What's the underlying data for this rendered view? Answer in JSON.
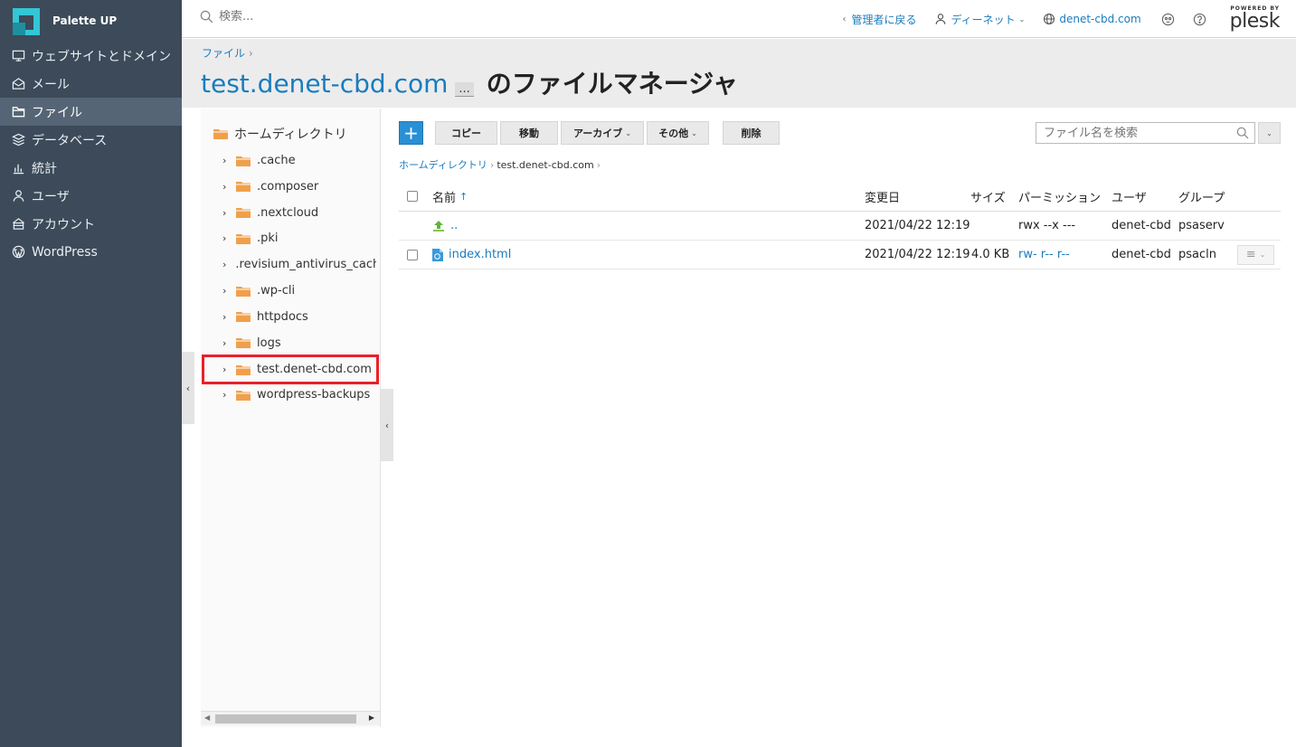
{
  "brand": {
    "name": "Palette UP"
  },
  "sidebar": {
    "items": [
      {
        "label": "ウェブサイトとドメイン",
        "icon": "monitor-icon"
      },
      {
        "label": "メール",
        "icon": "mail-icon"
      },
      {
        "label": "ファイル",
        "icon": "folder-icon",
        "active": true
      },
      {
        "label": "データベース",
        "icon": "database-icon"
      },
      {
        "label": "統計",
        "icon": "bar-chart-icon"
      },
      {
        "label": "ユーザ",
        "icon": "user-icon"
      },
      {
        "label": "アカウント",
        "icon": "account-icon"
      },
      {
        "label": "WordPress",
        "icon": "wordpress-icon"
      }
    ]
  },
  "topbar": {
    "search_placeholder": "検索...",
    "back_admin": "管理者に戻る",
    "user": "ディーネット",
    "domain": "denet-cbd.com",
    "powered_by": "POWERED BY",
    "plesk": "plesk"
  },
  "page": {
    "breadcrumb": "ファイル",
    "title_domain": "test.denet-cbd.com",
    "title_more": "...",
    "title_rest": "のファイルマネージャ"
  },
  "tree": {
    "root": "ホームディレクトリ",
    "items": [
      ".cache",
      ".composer",
      ".nextcloud",
      ".pki",
      ".revisium_antivirus_cache",
      ".wp-cli",
      "httpdocs",
      "logs",
      "test.denet-cbd.com",
      "wordpress-backups"
    ]
  },
  "toolbar": {
    "add": "+",
    "copy": "コピー",
    "move": "移動",
    "archive": "アーカイブ",
    "other": "その他",
    "delete": "削除",
    "search_placeholder": "ファイル名を検索"
  },
  "path": {
    "home": "ホームディレクトリ",
    "current": "test.denet-cbd.com"
  },
  "table": {
    "headers": {
      "name": "名前",
      "modified": "変更日",
      "size": "サイズ",
      "permission": "パーミッション",
      "user": "ユーザ",
      "group": "グループ"
    },
    "rows": [
      {
        "name": "..",
        "modified": "2021/04/22 12:19",
        "size": "",
        "permission": "rwx --x ---",
        "user": "denet-cbd",
        "group": "psaserv"
      },
      {
        "name": "index.html",
        "modified": "2021/04/22 12:19",
        "size": "4.0 KB",
        "permission": "rw- r-- r--",
        "user": "denet-cbd",
        "group": "psacln"
      }
    ]
  },
  "colors": {
    "sidebar_bg": "#3c4a59",
    "accent": "#1a7cbd",
    "brand": "#33c6d6",
    "folder": "#f0a04b",
    "highlight": "#e8202a"
  }
}
